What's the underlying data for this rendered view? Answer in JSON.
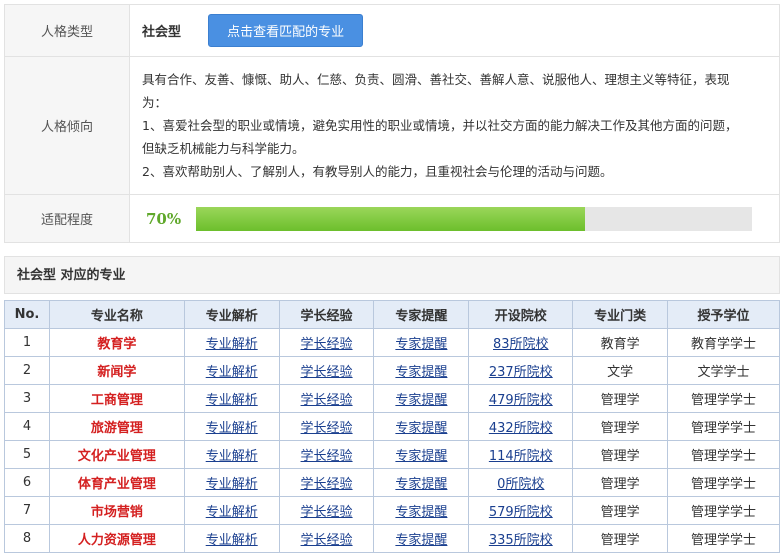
{
  "personality": {
    "type_label": "人格类型",
    "type_value": "社会型",
    "match_button": "点击查看匹配的专业",
    "tendency_label": "人格倾向",
    "tendency_lines": [
      "具有合作、友善、慷慨、助人、仁慈、负责、圆滑、善社交、善解人意、说服他人、理想主义等特征，表现",
      "为：",
      "1、喜爱社会型的职业或情境，避免实用性的职业或情境，并以社交方面的能力解决工作及其他方面的问题，",
      "但缺乏机械能力与科学能力。",
      "2、喜欢帮助别人、了解别人，有教导别人的能力，且重视社会与伦理的活动与问题。"
    ],
    "fit_label": "适配程度",
    "fit_percent_text": "70%",
    "fit_value": 0.7
  },
  "section_title": "社会型 对应的专业",
  "table": {
    "headers": [
      "No.",
      "专业名称",
      "专业解析",
      "学长经验",
      "专家提醒",
      "开设院校",
      "专业门类",
      "授予学位"
    ],
    "rows": [
      {
        "no": "1",
        "name": "教育学",
        "analysis": "专业解析",
        "exp": "学长经验",
        "remind": "专家提醒",
        "schools": "83所院校",
        "category": "教育学",
        "degree": "教育学学士"
      },
      {
        "no": "2",
        "name": "新闻学",
        "analysis": "专业解析",
        "exp": "学长经验",
        "remind": "专家提醒",
        "schools": "237所院校",
        "category": "文学",
        "degree": "文学学士"
      },
      {
        "no": "3",
        "name": "工商管理",
        "analysis": "专业解析",
        "exp": "学长经验",
        "remind": "专家提醒",
        "schools": "479所院校",
        "category": "管理学",
        "degree": "管理学学士"
      },
      {
        "no": "4",
        "name": "旅游管理",
        "analysis": "专业解析",
        "exp": "学长经验",
        "remind": "专家提醒",
        "schools": "432所院校",
        "category": "管理学",
        "degree": "管理学学士"
      },
      {
        "no": "5",
        "name": "文化产业管理",
        "analysis": "专业解析",
        "exp": "学长经验",
        "remind": "专家提醒",
        "schools": "114所院校",
        "category": "管理学",
        "degree": "管理学学士"
      },
      {
        "no": "6",
        "name": "体育产业管理",
        "analysis": "专业解析",
        "exp": "学长经验",
        "remind": "专家提醒",
        "schools": "0所院校",
        "category": "管理学",
        "degree": "管理学学士"
      },
      {
        "no": "7",
        "name": "市场营销",
        "analysis": "专业解析",
        "exp": "学长经验",
        "remind": "专家提醒",
        "schools": "579所院校",
        "category": "管理学",
        "degree": "管理学学士"
      },
      {
        "no": "8",
        "name": "人力资源管理",
        "analysis": "专业解析",
        "exp": "学长经验",
        "remind": "专家提醒",
        "schools": "335所院校",
        "category": "管理学",
        "degree": "管理学学士"
      }
    ]
  }
}
